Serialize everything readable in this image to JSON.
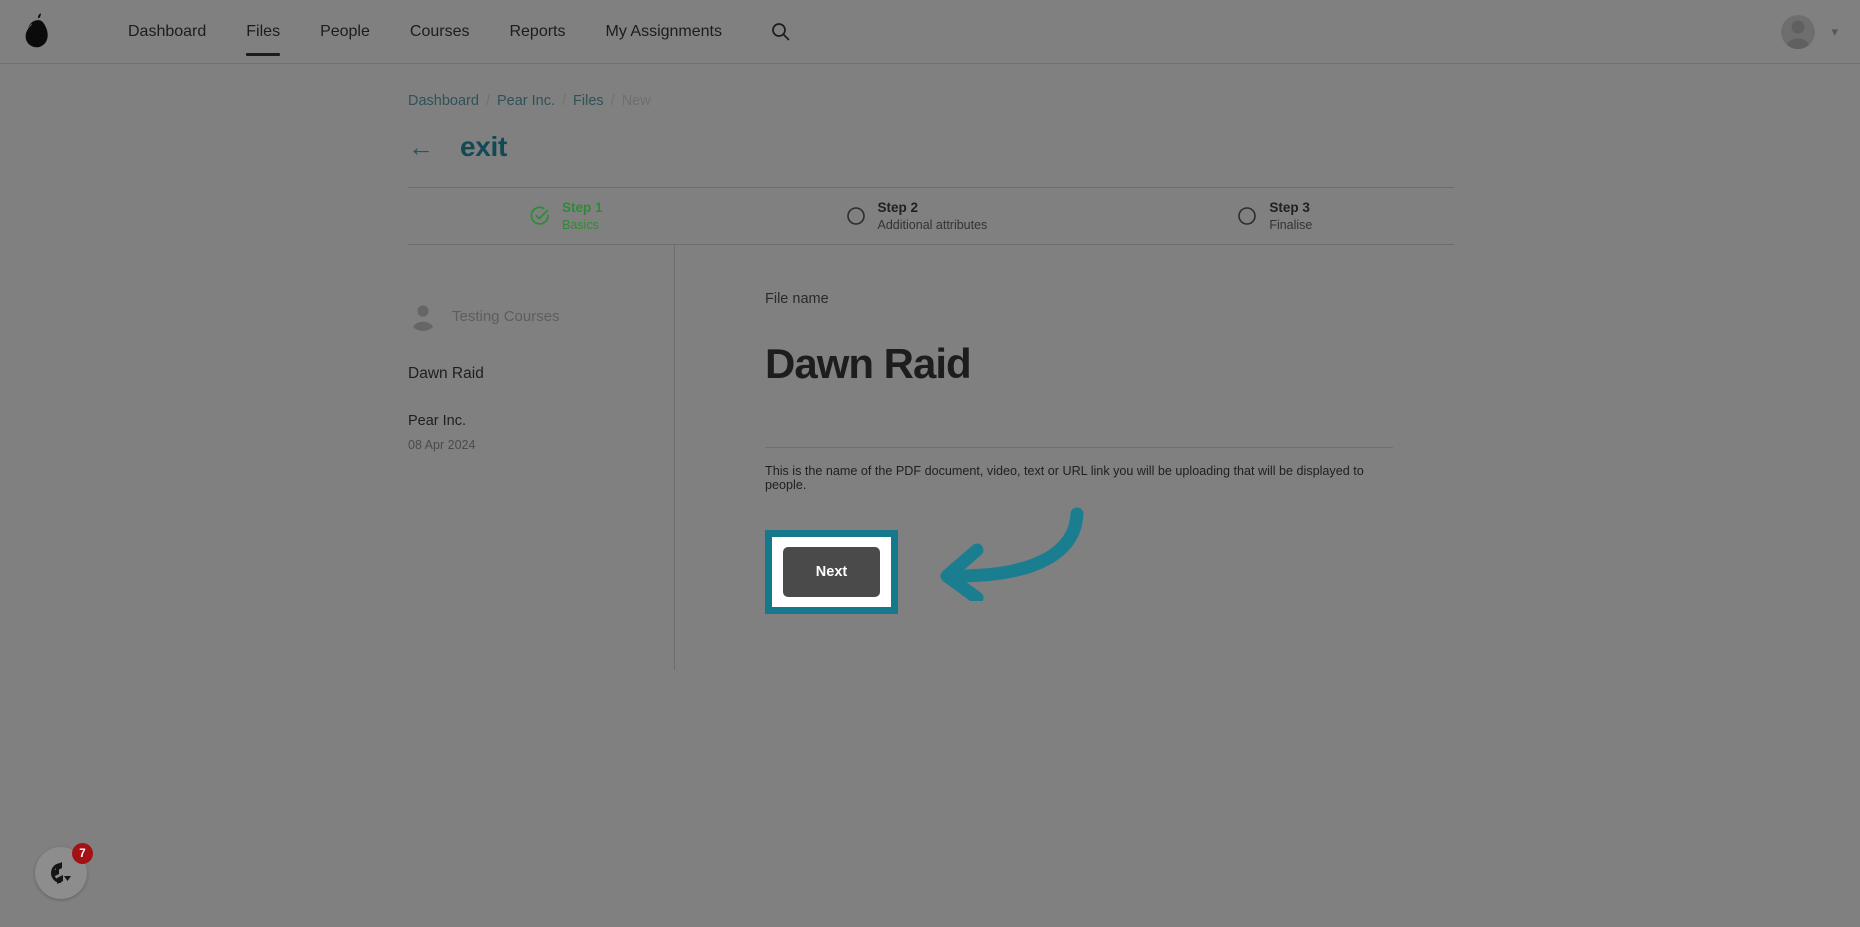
{
  "app": {
    "logo_icon": "pear-logo-icon"
  },
  "nav": {
    "items": [
      {
        "label": "Dashboard",
        "active": false
      },
      {
        "label": "Files",
        "active": true
      },
      {
        "label": "People",
        "active": false
      },
      {
        "label": "Courses",
        "active": false
      },
      {
        "label": "Reports",
        "active": false
      },
      {
        "label": "My Assignments",
        "active": false
      }
    ],
    "search_icon": "search-icon",
    "avatar_icon": "user-avatar-icon",
    "chevron_icon": "chevron-down-icon"
  },
  "breadcrumb": {
    "items": [
      "Dashboard",
      "Pear Inc.",
      "Files",
      "New"
    ],
    "separator": "/"
  },
  "exit": {
    "arrow": "←",
    "label": "exit"
  },
  "stepper": {
    "steps": [
      {
        "title": "Step 1",
        "sub": "Basics",
        "state": "done",
        "icon": "check-circle-icon"
      },
      {
        "title": "Step 2",
        "sub": "Additional attributes",
        "state": "todo",
        "icon": "circle-icon"
      },
      {
        "title": "Step 3",
        "sub": "Finalise",
        "state": "todo",
        "icon": "circle-icon"
      }
    ],
    "done_color": "#2e8b35"
  },
  "left_panel": {
    "org_avatar_icon": "org-avatar-icon",
    "org_name": "Testing Courses",
    "title": "Dawn Raid",
    "company": "Pear Inc.",
    "date": "08 Apr 2024"
  },
  "form": {
    "field_label": "File name",
    "field_value": "Dawn Raid",
    "field_placeholder": "File name",
    "field_help": "This is the name of the PDF document, video, text or URL link you will be uploading that will be displayed to people.",
    "next_label": "Next"
  },
  "annotation": {
    "highlight_color": "#16798b",
    "arrow_icon": "curved-arrow-left-icon"
  },
  "chat": {
    "icon": "chat-widget-icon",
    "badge_count": "7",
    "badge_color": "#a31114"
  }
}
